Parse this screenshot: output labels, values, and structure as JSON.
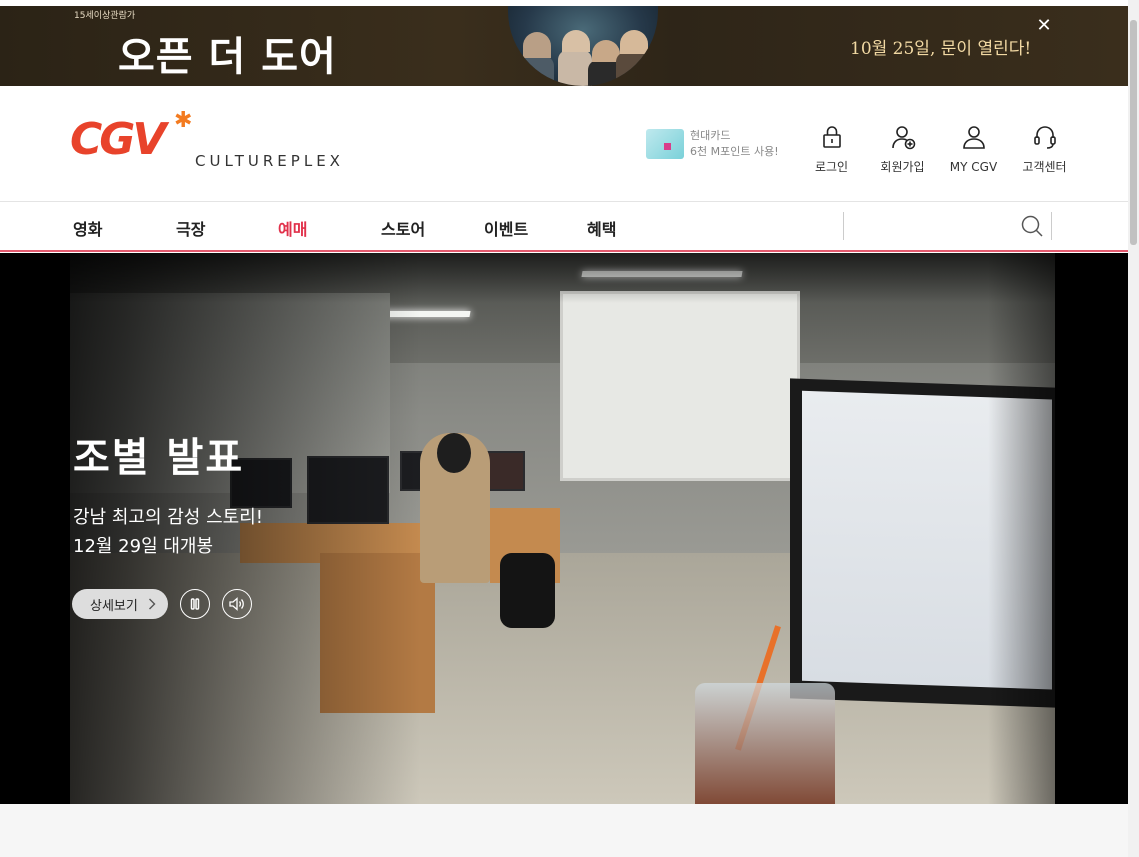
{
  "ad": {
    "rating": "15세이상관람가",
    "title": "오픈 더 도어",
    "tagline": "10월 25일, 문이 열린다!",
    "close_label": "✕"
  },
  "header": {
    "logo_text": "CGV",
    "logo_sub": "CULTUREPLEX",
    "card_promo": {
      "line1": "현대카드",
      "line2": "6천 M포인트 사용!"
    },
    "user_menu": [
      {
        "label": "로그인",
        "icon": "lock-icon"
      },
      {
        "label": "회원가입",
        "icon": "user-add-icon"
      },
      {
        "label": "MY CGV",
        "icon": "user-icon"
      },
      {
        "label": "고객센터",
        "icon": "headset-icon"
      }
    ]
  },
  "nav": {
    "items": [
      {
        "label": "영화"
      },
      {
        "label": "극장"
      },
      {
        "label": "예매",
        "active": true
      },
      {
        "label": "스토어"
      },
      {
        "label": "이벤트"
      },
      {
        "label": "혜택"
      }
    ],
    "search_placeholder": ""
  },
  "hero": {
    "title": "조별 발표",
    "subtitle_line1": "강남 최고의 감성 스토리!",
    "subtitle_line2": "12월 29일 대개봉",
    "detail_label": "상세보기"
  },
  "colors": {
    "brand_red": "#e8432b",
    "nav_active": "#e1314b",
    "nav_border": "#e35a6e"
  }
}
